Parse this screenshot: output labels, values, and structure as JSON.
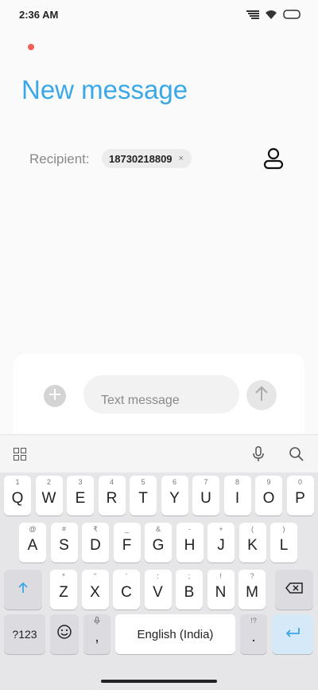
{
  "status_bar": {
    "time": "2:36 AM"
  },
  "header": {
    "title": "New message"
  },
  "recipient": {
    "label": "Recipient:",
    "chip_value": "18730218809",
    "chip_close": "×"
  },
  "composer": {
    "placeholder": "Text message"
  },
  "icons": {
    "signal": "signal-bars-icon",
    "wifi": "wifi-icon",
    "battery": "battery-icon",
    "contact": "person-icon",
    "attach": "plus-icon",
    "send": "arrow-up-icon",
    "apps": "grid-icon",
    "mic": "microphone-icon",
    "search": "search-icon",
    "shift": "shift-arrow-icon",
    "backspace": "backspace-icon",
    "emoji": "emoji-icon",
    "enter": "enter-icon"
  },
  "colors": {
    "accent": "#3aa8e6",
    "recording_dot": "#f0605a",
    "enter_key": "#d6e9f8",
    "enter_glyph": "#3aa8e6"
  },
  "keyboard": {
    "row1": [
      {
        "k": "Q",
        "h": "1"
      },
      {
        "k": "W",
        "h": "2"
      },
      {
        "k": "E",
        "h": "3"
      },
      {
        "k": "R",
        "h": "4"
      },
      {
        "k": "T",
        "h": "5"
      },
      {
        "k": "Y",
        "h": "6"
      },
      {
        "k": "U",
        "h": "7"
      },
      {
        "k": "I",
        "h": "8"
      },
      {
        "k": "O",
        "h": "9"
      },
      {
        "k": "P",
        "h": "0"
      }
    ],
    "row2": [
      {
        "k": "A",
        "h": "@"
      },
      {
        "k": "S",
        "h": "#"
      },
      {
        "k": "D",
        "h": "₹"
      },
      {
        "k": "F",
        "h": "_"
      },
      {
        "k": "G",
        "h": "&"
      },
      {
        "k": "H",
        "h": "-"
      },
      {
        "k": "J",
        "h": "+"
      },
      {
        "k": "K",
        "h": "("
      },
      {
        "k": "L",
        "h": ")"
      }
    ],
    "row3": [
      {
        "k": "Z",
        "h": "*"
      },
      {
        "k": "X",
        "h": "\""
      },
      {
        "k": "C",
        "h": "'"
      },
      {
        "k": "V",
        "h": ":"
      },
      {
        "k": "B",
        "h": ";"
      },
      {
        "k": "N",
        "h": "!"
      },
      {
        "k": "M",
        "h": "?"
      }
    ],
    "symbols_label": "?123",
    "comma_label": ",",
    "space_label": "English (India)",
    "period_label": ".",
    "period_hint": "!?"
  }
}
